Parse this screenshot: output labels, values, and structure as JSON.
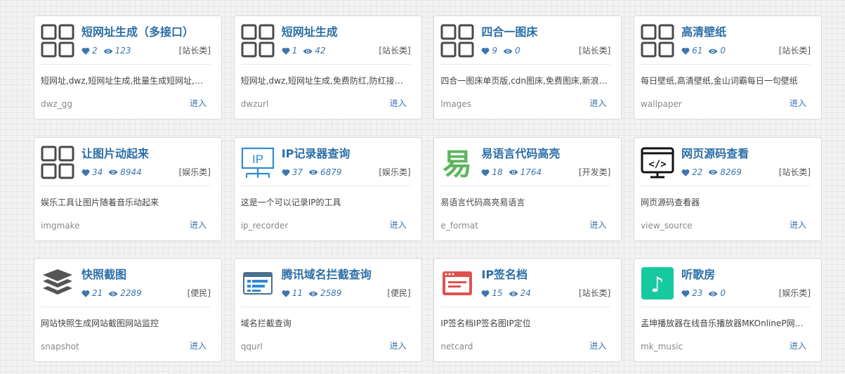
{
  "labels": {
    "enter": "进入"
  },
  "colors": {
    "title": "#2b6ea6",
    "stats": "#3e75ae",
    "link": "#3a73b0"
  },
  "cards": [
    {
      "title": "短网址生成（多接口）",
      "likes": "2",
      "views": "123",
      "category": "[站长类]",
      "desc": "短网址,dwz,短网址生成,批量生成短网址,免费防红,防红接口",
      "slug": "dwz_gg",
      "icon": "placeholder-squares-icon"
    },
    {
      "title": "短网址生成",
      "likes": "1",
      "views": "42",
      "category": "[站长类]",
      "desc": "短网址,dwz,短网址生成,免费防红,防红接口,批量生成",
      "slug": "dwzurl",
      "icon": "placeholder-squares-icon"
    },
    {
      "title": "四合一图床",
      "likes": "9",
      "views": "0",
      "category": "[站长类]",
      "desc": "四合一图床单页版,cdn图床,免费图床,新浪图床",
      "slug": "lmages",
      "icon": "placeholder-squares-icon"
    },
    {
      "title": "高清壁纸",
      "likes": "61",
      "views": "0",
      "category": "[站长类]",
      "desc": "每日壁纸,高清壁纸,金山词霸每日一句壁纸",
      "slug": "wallpaper",
      "icon": "placeholder-squares-icon"
    },
    {
      "title": "让图片动起来",
      "likes": "34",
      "views": "8944",
      "category": "[娱乐类]",
      "desc": "娱乐工具让图片随着音乐动起来",
      "slug": "imgmake",
      "icon": "placeholder-squares-icon"
    },
    {
      "title": "IP记录器查询",
      "likes": "37",
      "views": "6879",
      "category": "[娱乐类]",
      "desc": "这是一个可以记录IP的工具",
      "slug": "ip_recorder",
      "icon": "ip-monitor-icon",
      "icon_text": "IP"
    },
    {
      "title": "易语言代码高亮",
      "likes": "18",
      "views": "1764",
      "category": "[开发类]",
      "desc": "易语言代码高亮易语言",
      "slug": "e_format",
      "icon": "yi-language-icon",
      "icon_text": "易"
    },
    {
      "title": "网页源码查看",
      "likes": "22",
      "views": "8269",
      "category": "[站长类]",
      "desc": "网页源码查看器",
      "slug": "view_source",
      "icon": "code-monitor-icon",
      "icon_text": "</>"
    },
    {
      "title": "快照截图",
      "likes": "21",
      "views": "2289",
      "category": "[便民]",
      "desc": "网站快照生成网站截图网站监控",
      "slug": "snapshot",
      "icon": "layers-icon"
    },
    {
      "title": "腾讯域名拦截查询",
      "likes": "11",
      "views": "2589",
      "category": "[便民]",
      "desc": "域名拦截查询",
      "slug": "qqurl",
      "icon": "browser-list-icon"
    },
    {
      "title": "IP签名档",
      "likes": "15",
      "views": "24",
      "category": "[站长类]",
      "desc": "IP签名档IP签名图IP定位",
      "slug": "netcard",
      "icon": "browser-window-icon"
    },
    {
      "title": "听歌房",
      "likes": "23",
      "views": "0",
      "category": "[娱乐类]",
      "desc": "孟坤播放器在线音乐播放器MKOnlineP网页播放器",
      "slug": "mk_music",
      "icon": "music-note-icon",
      "icon_text": "♪"
    }
  ]
}
